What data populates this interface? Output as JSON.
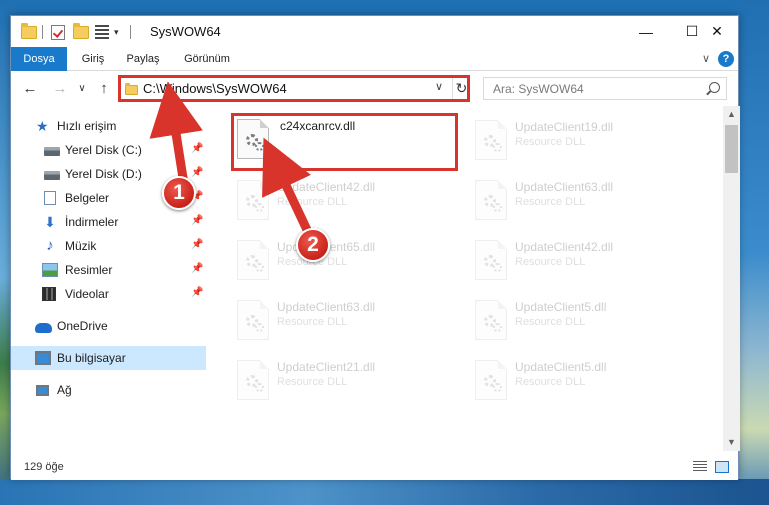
{
  "window": {
    "title": "SysWOW64",
    "minimize": "—",
    "maximize": "☐",
    "close": "✕"
  },
  "ribbon": {
    "tabs": [
      {
        "label": "Dosya",
        "active": true
      },
      {
        "label": "Giriş"
      },
      {
        "label": "Paylaş"
      },
      {
        "label": "Görünüm"
      }
    ],
    "help": "?"
  },
  "address_bar": {
    "path": "C:\\Windows\\SysWOW64",
    "dropdown": "∨",
    "refresh": "↻"
  },
  "search": {
    "placeholder": "Ara: SysWOW64"
  },
  "nav": {
    "back": "←",
    "forward": "→",
    "recent": "∨",
    "up": "↑"
  },
  "sidebar": {
    "items": [
      {
        "label": "Hızlı erişim",
        "icon": "star-icon"
      },
      {
        "label": "Yerel Disk (C:)",
        "icon": "disk-icon",
        "pinned": true
      },
      {
        "label": "Yerel Disk (D:)",
        "icon": "disk-icon",
        "pinned": true
      },
      {
        "label": "Belgeler",
        "icon": "documents-icon",
        "pinned": true
      },
      {
        "label": "İndirmeler",
        "icon": "download-icon",
        "pinned": true
      },
      {
        "label": "Müzik",
        "icon": "music-icon",
        "pinned": true
      },
      {
        "label": "Resimler",
        "icon": "pictures-icon",
        "pinned": true
      },
      {
        "label": "Videolar",
        "icon": "videos-icon",
        "pinned": true
      },
      {
        "label": "OneDrive",
        "icon": "onedrive-icon"
      },
      {
        "label": "Bu bilgisayar",
        "icon": "this-pc-icon",
        "selected": true
      },
      {
        "label": "Ağ",
        "icon": "network-icon"
      }
    ]
  },
  "files": {
    "highlighted": {
      "name": "c24xcanrcv.dll",
      "type": ""
    },
    "items": [
      {
        "name": "UpdateClient19.dll",
        "type": "Resource DLL"
      },
      {
        "name": "UpdateClient42.dll",
        "type": "Resource DLL"
      },
      {
        "name": "UpdateClient63.dll",
        "type": "Resource DLL"
      },
      {
        "name": "UpdateClient65.dll",
        "type": "Resource DLL"
      },
      {
        "name": "UpdateClient42.dll",
        "type": "Resource DLL"
      },
      {
        "name": "UpdateClient63.dll",
        "type": "Resource DLL"
      },
      {
        "name": "UpdateClient5.dll",
        "type": "Resource DLL"
      },
      {
        "name": "UpdateClient21.dll",
        "type": "Resource DLL"
      },
      {
        "name": "UpdateClient5.dll",
        "type": "Resource DLL"
      }
    ]
  },
  "status": {
    "item_count": "129 öğe"
  },
  "annotations": {
    "step1": "1",
    "step2": "2",
    "color": "#d9342b"
  }
}
